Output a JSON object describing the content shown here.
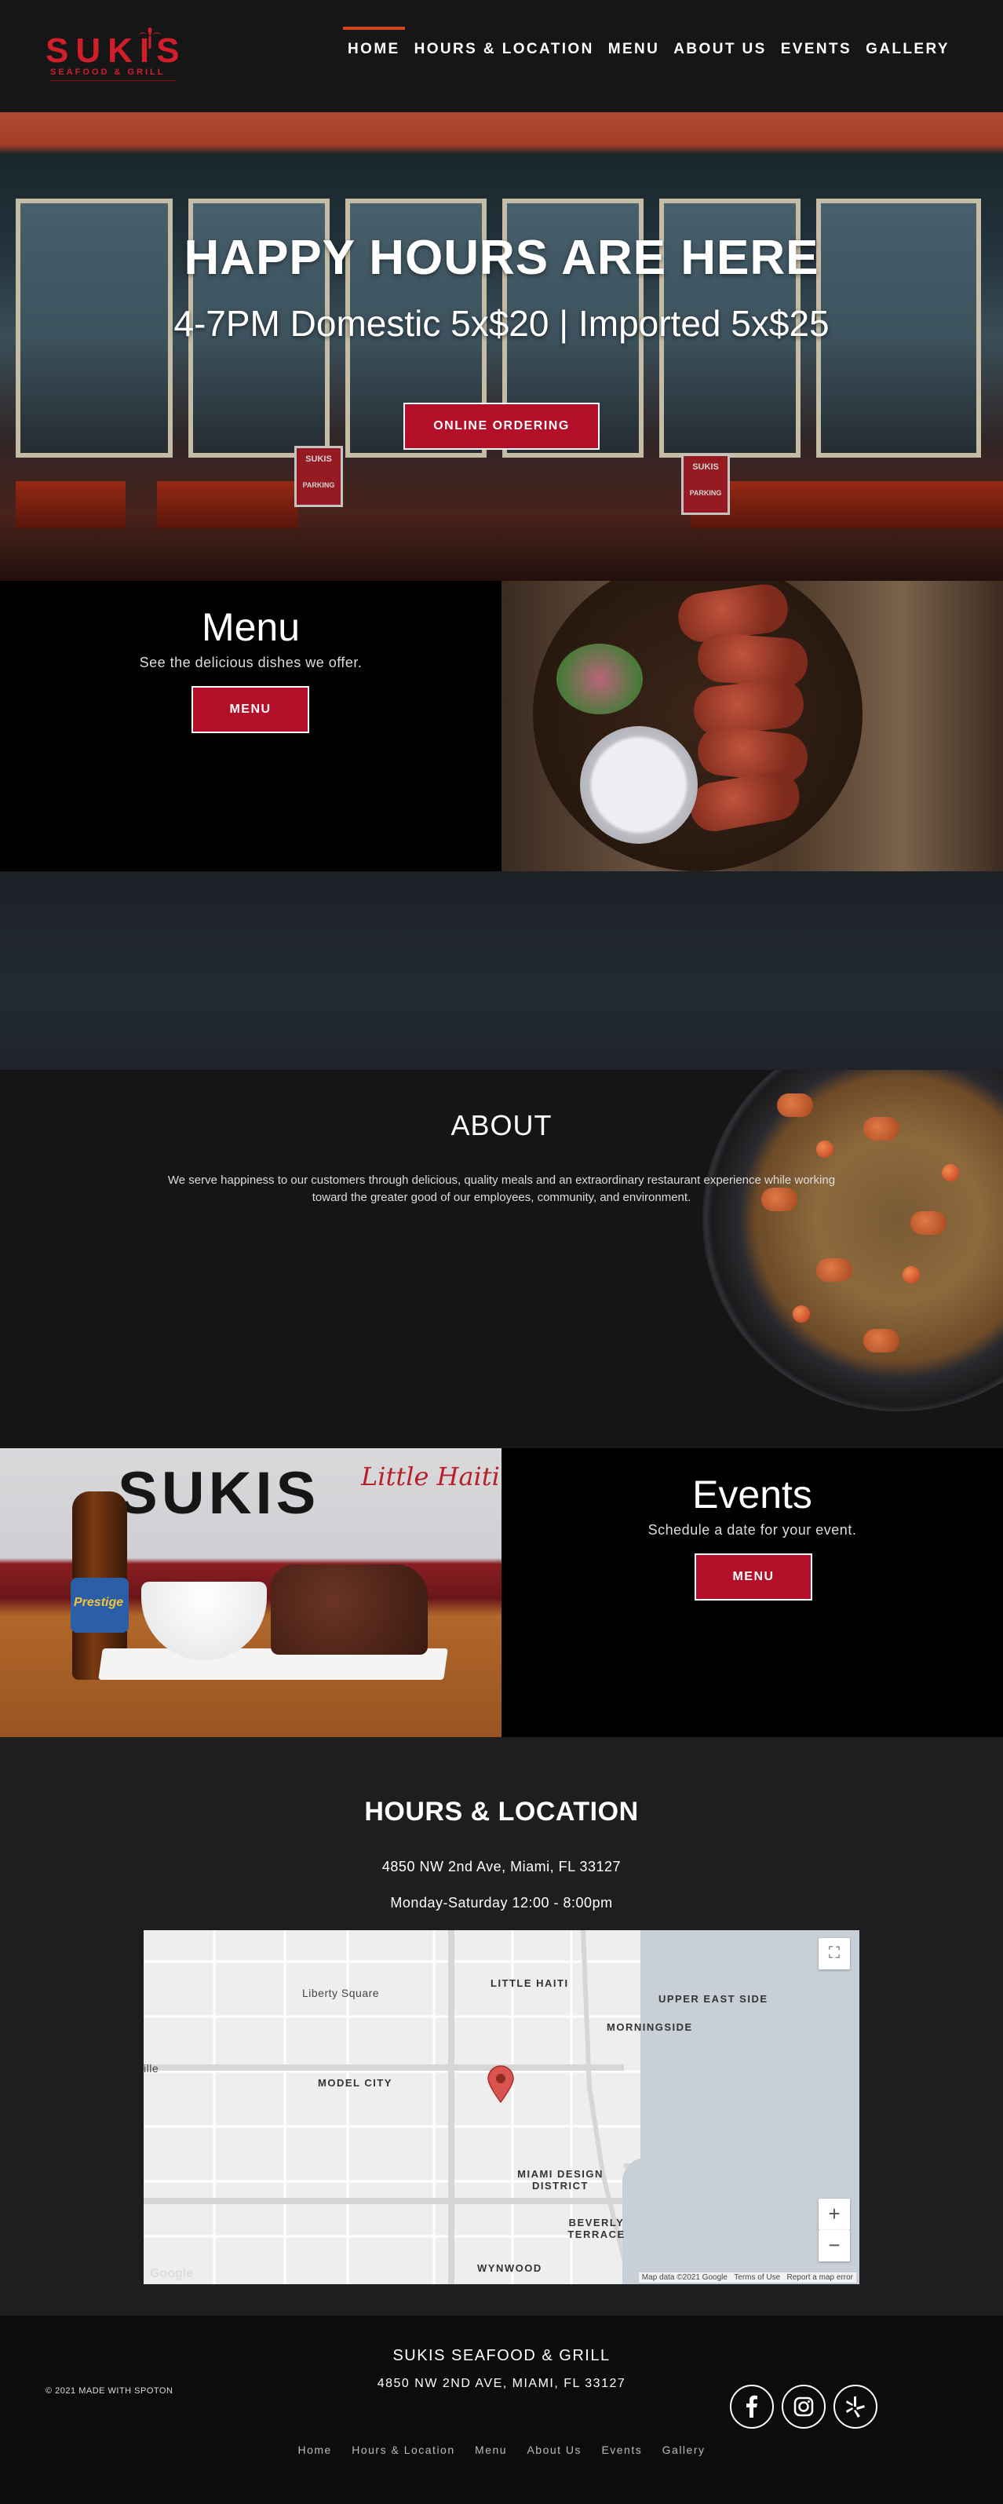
{
  "nav": {
    "logo_text": "SUKIS",
    "logo_sub": "SEAFOOD & GRILL",
    "links": [
      "HOME",
      "HOURS & LOCATION",
      "MENU",
      "ABOUT US",
      "EVENTS",
      "GALLERY"
    ],
    "active": "HOME"
  },
  "hero": {
    "title": "HAPPY HOURS ARE HERE",
    "subtitle": "4-7PM Domestic 5x$20 | Imported 5x$25",
    "button": "ONLINE ORDERING",
    "signs": [
      "SUKIS",
      "PARKING"
    ]
  },
  "menu": {
    "title": "Menu",
    "description": "See the delicious dishes we offer.",
    "button": "MENU"
  },
  "about": {
    "title": "ABOUT",
    "body": "We serve happiness to our customers through delicious, quality meals and an extraordinary restaurant experience while working toward the greater good of our employees, community, and environment."
  },
  "events": {
    "title": "Events",
    "description": "Schedule a date for your event.",
    "button": "MENU",
    "wall_text": "SUKIS",
    "wall_red": "Little Haiti",
    "bottle_label": "Prestige"
  },
  "hours": {
    "title": "HOURS & LOCATION",
    "address": "4850 NW 2nd Ave, Miami, FL 33127",
    "time": "Monday-Saturday 12:00 - 8:00pm",
    "map": {
      "labels": [
        "Liberty Square",
        "LITTLE HAITI",
        "UPPER EAST SIDE",
        "MORNINGSIDE",
        "MODEL CITY",
        "MIAMI DESIGN DISTRICT",
        "BEVERLY TERRACE",
        "WYNWOOD",
        "ille"
      ],
      "footer": [
        "Map data ©2021 Google",
        "Terms of Use",
        "Report a map error"
      ],
      "google": "Google",
      "zoom_in": "+",
      "zoom_out": "−",
      "fullscreen": "⛶"
    }
  },
  "footer": {
    "name": "SUKIS SEAFOOD & GRILL",
    "address": "4850 NW 2ND AVE, MIAMI, FL 33127",
    "copyright": "© 2021 MADE WITH SPOTON",
    "links": [
      "Home",
      "Hours & Location",
      "Menu",
      "About Us",
      "Events",
      "Gallery"
    ],
    "social": [
      "facebook-icon",
      "instagram-icon",
      "yelp-icon"
    ]
  },
  "colors": {
    "brand_red": "#b30f28",
    "logo_red": "#d21d2b",
    "nav_bg": "#161616",
    "active_underline": "#d2451e"
  }
}
